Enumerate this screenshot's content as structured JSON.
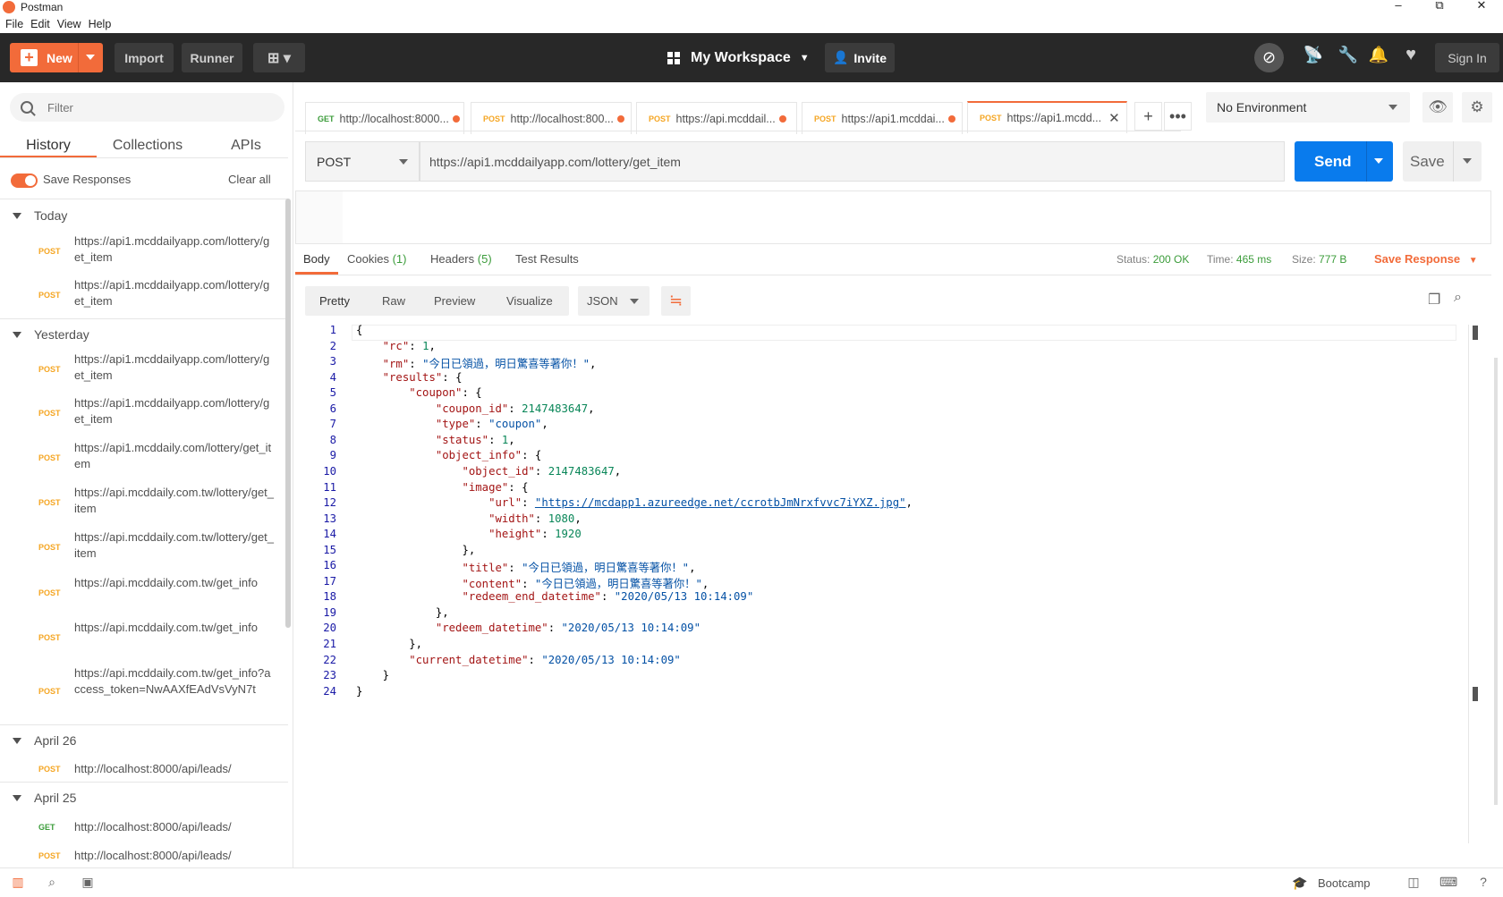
{
  "window": {
    "title": "Postman",
    "minimize": "–",
    "maximize": "⧉",
    "close": "✕"
  },
  "menu": [
    "File",
    "Edit",
    "View",
    "Help"
  ],
  "header": {
    "new_label": "New",
    "import_label": "Import",
    "runner_label": "Runner",
    "workspace_label": "My Workspace",
    "invite_label": "Invite",
    "signin_label": "Sign In"
  },
  "sidebar": {
    "filter_placeholder": "Filter",
    "tabs": [
      "History",
      "Collections",
      "APIs"
    ],
    "save_responses_label": "Save Responses",
    "clear_all_label": "Clear all",
    "groups": [
      {
        "label": "Today",
        "items": [
          {
            "method": "POST",
            "url": "https://api1.mcddailyapp.com/lottery/get_item"
          },
          {
            "method": "POST",
            "url": "https://api1.mcddailyapp.com/lottery/get_item"
          }
        ]
      },
      {
        "label": "Yesterday",
        "items": [
          {
            "method": "POST",
            "url": "https://api1.mcddailyapp.com/lottery/get_item"
          },
          {
            "method": "POST",
            "url": "https://api1.mcddailyapp.com/lottery/get_item"
          },
          {
            "method": "POST",
            "url": "https://api1.mcddaily.com/lottery/get_item"
          },
          {
            "method": "POST",
            "url": "https://api.mcddaily.com.tw/lottery/get_item"
          },
          {
            "method": "POST",
            "url": "https://api.mcddaily.com.tw/lottery/get_item"
          },
          {
            "method": "POST",
            "url": "https://api.mcddaily.com.tw/get_info"
          },
          {
            "method": "POST",
            "url": "https://api.mcddaily.com.tw/get_info"
          },
          {
            "method": "POST",
            "url": "https://api.mcddaily.com.tw/get_info?access_token=NwAAXfEAdVsVyN7t"
          }
        ]
      },
      {
        "label": "April 26",
        "items": [
          {
            "method": "POST",
            "url": "http://localhost:8000/api/leads/"
          }
        ]
      },
      {
        "label": "April 25",
        "items": [
          {
            "method": "GET",
            "url": "http://localhost:8000/api/leads/"
          },
          {
            "method": "POST",
            "url": "http://localhost:8000/api/leads/"
          }
        ]
      }
    ]
  },
  "request_tabs": [
    {
      "method": "GET",
      "label": "http://localhost:8000..."
    },
    {
      "method": "POST",
      "label": "http://localhost:800..."
    },
    {
      "method": "POST",
      "label": "https://api.mcddail..."
    },
    {
      "method": "POST",
      "label": "https://api1.mcddai..."
    },
    {
      "method": "POST",
      "label": "https://api1.mcdd..."
    }
  ],
  "environment": {
    "selected": "No Environment"
  },
  "request": {
    "method": "POST",
    "url": "https://api1.mcddailyapp.com/lottery/get_item",
    "send_label": "Send",
    "save_label": "Save"
  },
  "response": {
    "tabs": {
      "body": "Body",
      "cookies": "Cookies",
      "cookies_count": "(1)",
      "headers": "Headers",
      "headers_count": "(5)",
      "tests": "Test Results"
    },
    "status_label": "Status:",
    "status_value": "200 OK",
    "time_label": "Time:",
    "time_value": "465 ms",
    "size_label": "Size:",
    "size_value": "777 B",
    "save_response_label": "Save Response",
    "view_modes": [
      "Pretty",
      "Raw",
      "Preview",
      "Visualize"
    ],
    "format": "JSON",
    "code_lines": [
      "{",
      "    \"rc\": 1,",
      "    \"rm\": \"今日已領過，明日驚喜等著你！\",",
      "    \"results\": {",
      "        \"coupon\": {",
      "            \"coupon_id\": 2147483647,",
      "            \"type\": \"coupon\",",
      "            \"status\": 1,",
      "            \"object_info\": {",
      "                \"object_id\": 2147483647,",
      "                \"image\": {",
      "                    \"url\": \"https://mcdapp1.azureedge.net/ccrotbJmNrxfvvc7iYXZ.jpg\",",
      "                    \"width\": 1080,",
      "                    \"height\": 1920",
      "                },",
      "                \"title\": \"今日已領過，明日驚喜等著你！\",",
      "                \"content\": \"今日已領過，明日驚喜等著你！\",",
      "                \"redeem_end_datetime\": \"2020/05/13 10:14:09\"",
      "            },",
      "            \"redeem_datetime\": \"2020/05/13 10:14:09\"",
      "        },",
      "        \"current_datetime\": \"2020/05/13 10:14:09\"",
      "    }",
      "}"
    ]
  },
  "footer": {
    "bootcamp_label": "Bootcamp"
  }
}
